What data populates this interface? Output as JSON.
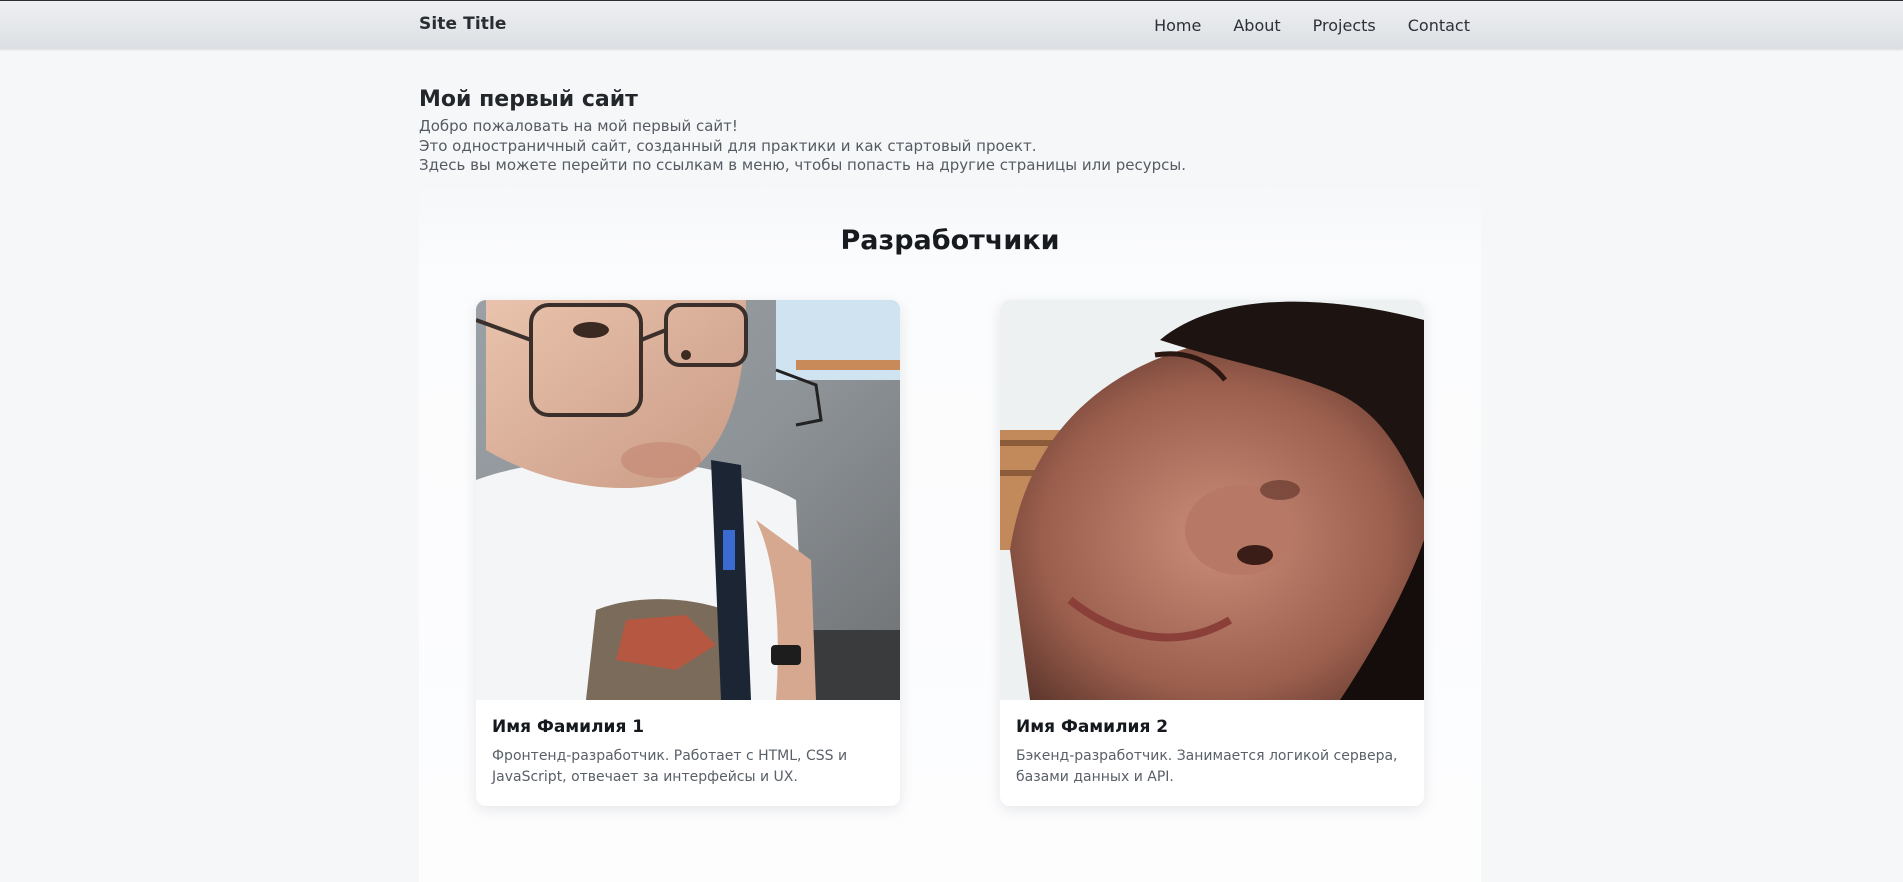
{
  "header": {
    "site_title": "Site Title",
    "nav": [
      {
        "label": "Home"
      },
      {
        "label": "About"
      },
      {
        "label": "Projects"
      },
      {
        "label": "Contact"
      }
    ]
  },
  "intro": {
    "title": "Мой первый сайт",
    "lines": [
      "Добро пожаловать на мой первый сайт!",
      "Это одностраничный сайт, созданный для практики и как стартовый проект.",
      "Здесь вы можете перейти по ссылкам в меню, чтобы попасть на другие страницы или ресурсы."
    ]
  },
  "developers": {
    "heading": "Разработчики",
    "cards": [
      {
        "name": "Имя Фамилия 1",
        "description": "Фронтенд-разработчик. Работает с HTML, CSS и JavaScript, отвечает за интерфейсы и UX.",
        "photo_icon": "developer-photo-1"
      },
      {
        "name": "Имя Фамилия 2",
        "description": "Бэкенд-разработчик. Занимается логикой сервера, базами данных и API.",
        "photo_icon": "developer-photo-2"
      }
    ]
  }
}
